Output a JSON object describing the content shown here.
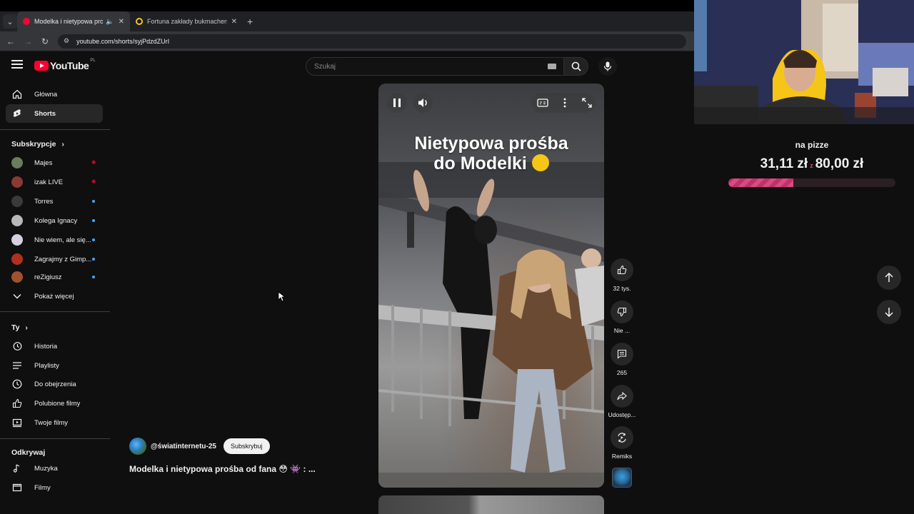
{
  "browser": {
    "tabs": [
      {
        "title": "Modelka i nietypowa prośba",
        "active": true,
        "audible": true,
        "favicon_color": "#ff0033"
      },
      {
        "title": "Fortuna zakłady bukmacherskie",
        "active": false,
        "audible": false,
        "favicon_color": "#f5c518"
      }
    ],
    "url": "youtube.com/shorts/syjPdzdZUrI"
  },
  "header": {
    "logo_text": "YouTube",
    "country_code": "PL",
    "search_placeholder": "Szukaj"
  },
  "sidebar": {
    "primary": [
      {
        "label": "Główna",
        "icon": "home-icon"
      },
      {
        "label": "Shorts",
        "icon": "shorts-icon",
        "active": true
      }
    ],
    "subscriptions_heading": "Subskrypcje",
    "subscriptions": [
      {
        "label": "Majes",
        "avatar_color": "#6b7d5a",
        "status": "live"
      },
      {
        "label": "izak LIVE",
        "avatar_color": "#8a3a32",
        "status": "live"
      },
      {
        "label": "Torres",
        "avatar_color": "#3a3a3a",
        "status": "new"
      },
      {
        "label": "Kolega Ignacy",
        "avatar_color": "#b8b8b8",
        "status": "new"
      },
      {
        "label": "Nie wiem, ale się...",
        "avatar_color": "#d4d0e0",
        "status": "new"
      },
      {
        "label": "Zagrajmy z Gimp...",
        "avatar_color": "#b03020",
        "status": "new"
      },
      {
        "label": "reZigiusz",
        "avatar_color": "#a0522d",
        "status": "new"
      }
    ],
    "show_more": "Pokaż więcej",
    "you_heading": "Ty",
    "you_items": [
      {
        "label": "Historia",
        "icon": "history-icon"
      },
      {
        "label": "Playlisty",
        "icon": "playlist-icon"
      },
      {
        "label": "Do obejrzenia",
        "icon": "watch-later-icon"
      },
      {
        "label": "Polubione filmy",
        "icon": "thumb-up-icon"
      },
      {
        "label": "Twoje filmy",
        "icon": "your-videos-icon"
      }
    ],
    "explore_heading": "Odkrywaj",
    "explore_items": [
      {
        "label": "Muzyka",
        "icon": "music-note-icon"
      },
      {
        "label": "Filmy",
        "icon": "movies-icon"
      }
    ]
  },
  "short": {
    "overlay_text_line1": "Nietypowa prośba",
    "overlay_text_line2": "do Modelki",
    "channel": "@światinternetu-25",
    "subscribe_label": "Subskrybuj",
    "title": "Modelka i nietypowa prośba od fana 😳 👾 : ...",
    "actions": {
      "like_count": "32 tys.",
      "dislike_label": "Nie ...",
      "comments_count": "265",
      "share_label": "Udostęp...",
      "remix_label": "Remiks"
    }
  },
  "donation_goal": {
    "title": "na pizze",
    "current": "31,11 zł",
    "separator": "z",
    "target": "80,00 zł",
    "progress_fraction": 0.39,
    "accent_color": "#d84a80"
  }
}
